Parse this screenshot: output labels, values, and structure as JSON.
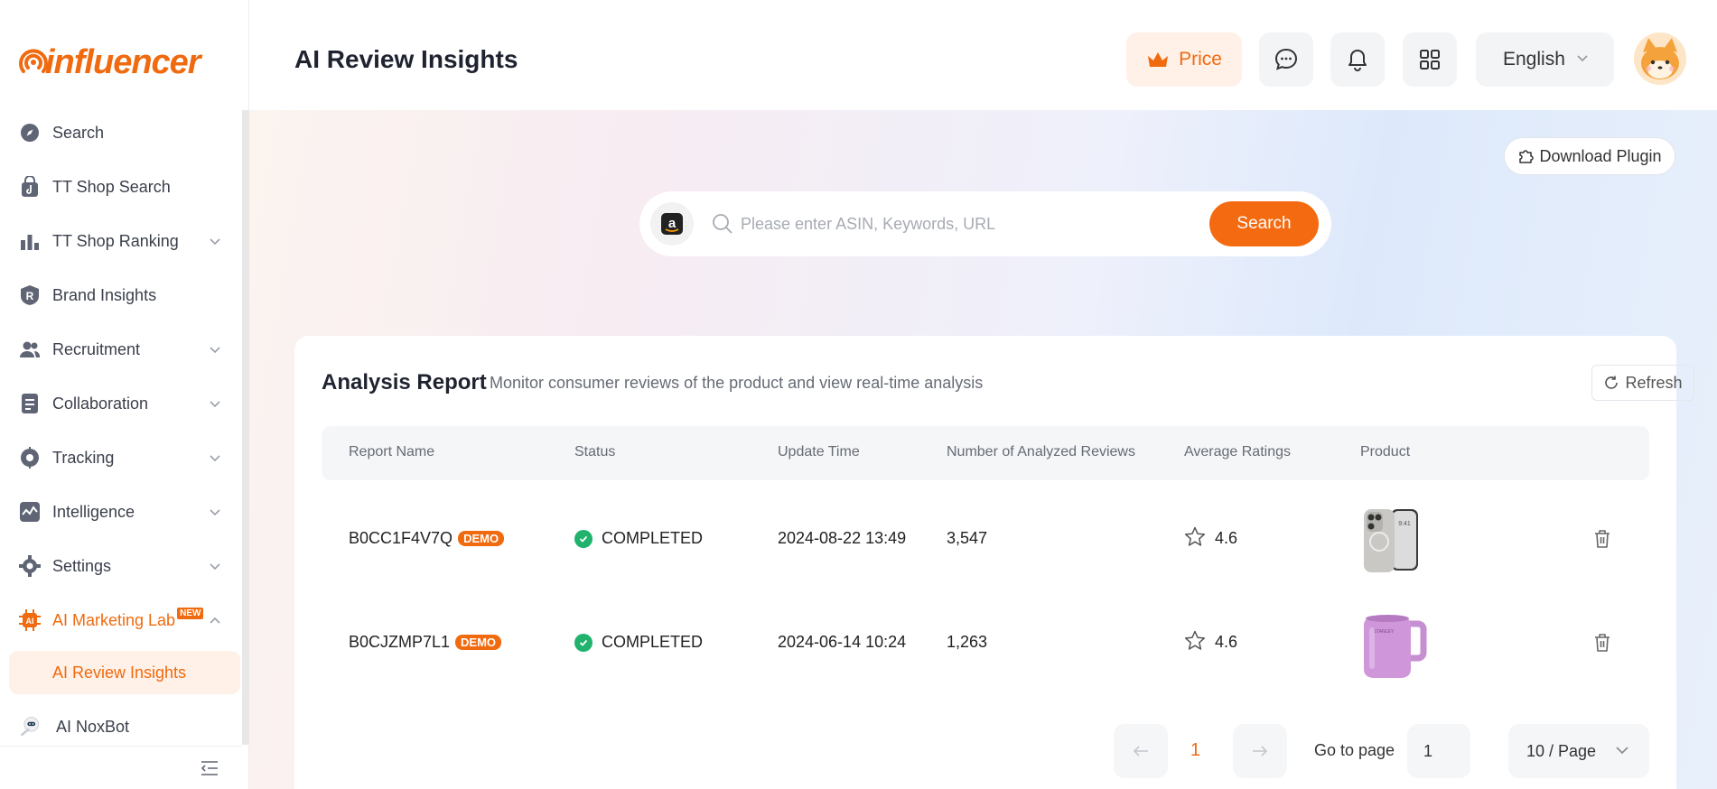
{
  "brand": {
    "logo_text": "influencer",
    "accent": "#f06a0f"
  },
  "sidebar": {
    "items": [
      {
        "label": "Search",
        "icon": "compass-icon",
        "has_chevron": false
      },
      {
        "label": "TT Shop Search",
        "icon": "tiktok-bag-icon",
        "has_chevron": false
      },
      {
        "label": "TT Shop Ranking",
        "icon": "bar-chart-icon",
        "has_chevron": true
      },
      {
        "label": "Brand Insights",
        "icon": "brand-r-icon",
        "has_chevron": false
      },
      {
        "label": "Recruitment",
        "icon": "users-icon",
        "has_chevron": true
      },
      {
        "label": "Collaboration",
        "icon": "document-icon",
        "has_chevron": true
      },
      {
        "label": "Tracking",
        "icon": "target-icon",
        "has_chevron": true
      },
      {
        "label": "Intelligence",
        "icon": "pulse-icon",
        "has_chevron": true
      },
      {
        "label": "Settings",
        "icon": "gear-icon",
        "has_chevron": true
      }
    ],
    "ai_lab": {
      "label": "AI Marketing Lab",
      "badge": "NEW",
      "icon": "ai-chip-icon"
    },
    "ai_lab_sub": {
      "label": "AI Review Insights"
    },
    "bot": {
      "label": "AI NoxBot",
      "icon": "robot-icon"
    }
  },
  "header": {
    "title": "AI Review Insights",
    "price_label": "Price",
    "language": "English"
  },
  "main": {
    "download_plugin": "Download Plugin",
    "search": {
      "placeholder": "Please enter ASIN, Keywords, URL",
      "button": "Search"
    },
    "report": {
      "title": "Analysis Report",
      "subtitle": "Monitor consumer reviews of the product and view real-time analysis",
      "refresh": "Refresh",
      "columns": [
        "Report Name",
        "Status",
        "Update Time",
        "Number of Analyzed Reviews",
        "Average Ratings",
        "Product"
      ],
      "rows": [
        {
          "name": "B0CC1F4V7Q",
          "badge": "DEMO",
          "status": "COMPLETED",
          "update_time": "2024-08-22 13:49",
          "reviews": "3,547",
          "rating": "4.6",
          "product": "phone-image"
        },
        {
          "name": "B0CJZMP7L1",
          "badge": "DEMO",
          "status": "COMPLETED",
          "update_time": "2024-06-14 10:24",
          "reviews": "1,263",
          "rating": "4.6",
          "product": "mug-image"
        }
      ]
    },
    "pagination": {
      "current_page": "1",
      "goto_label": "Go to page",
      "goto_value": "1",
      "page_size": "10 / Page"
    }
  }
}
